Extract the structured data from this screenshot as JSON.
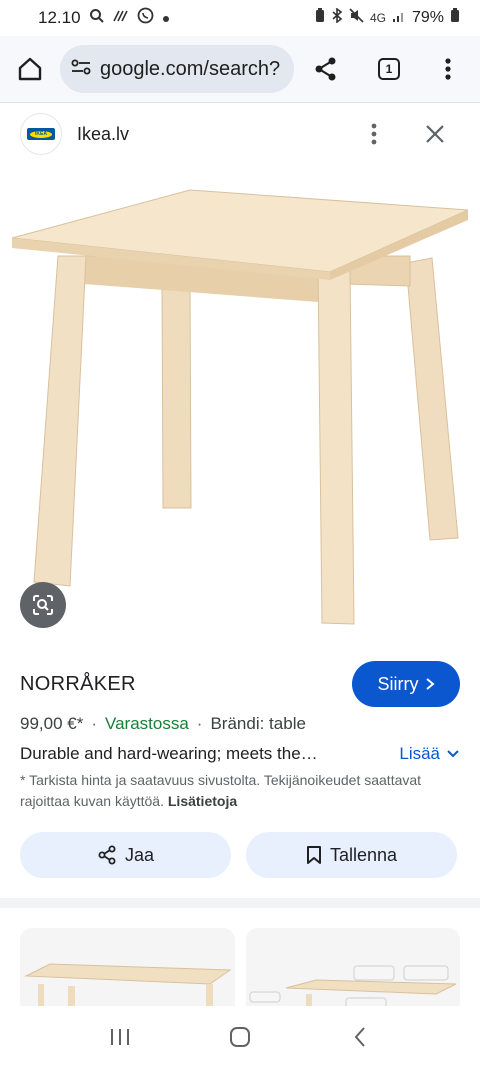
{
  "status_bar": {
    "time": "12.10",
    "battery": "79%",
    "network": "4G"
  },
  "browser": {
    "url": "google.com/search?",
    "tab_count": "1"
  },
  "site": {
    "name": "Ikea.lv",
    "logo_text": "IKEA"
  },
  "product": {
    "title": "NORRÅKER",
    "visit_label": "Siirry",
    "price": "99,00 €*",
    "availability": "Varastossa",
    "brand": "Brändi: table",
    "description": "Durable and hard-wearing; meets the…",
    "more_label": "Lisää",
    "disclaimer": "* Tarkista hinta ja saatavuus sivustolta. Tekijänoikeudet saattavat rajoittaa kuvan käyttöä.",
    "disclaimer_link": "Lisätietoja"
  },
  "actions": {
    "share_label": "Jaa",
    "save_label": "Tallenna"
  },
  "colors": {
    "accent": "#0b57d0",
    "in_stock": "#188038",
    "chip_bg": "#e8f0fe",
    "wood": "#f0dcbc"
  }
}
